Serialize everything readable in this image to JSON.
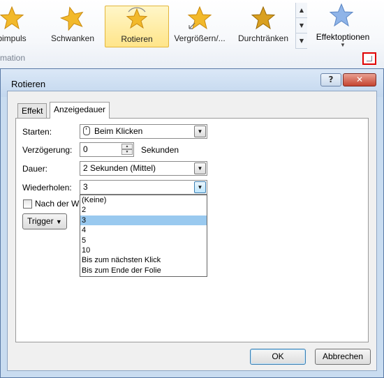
{
  "ribbon": {
    "gallery": [
      {
        "label": "bimpuls",
        "icon": "star-pulse-icon"
      },
      {
        "label": "Schwanken",
        "icon": "star-teeter-icon"
      },
      {
        "label": "Rotieren",
        "icon": "star-spin-icon",
        "selected": true
      },
      {
        "label": "Vergrößern/...",
        "icon": "star-grow-icon"
      },
      {
        "label": "Durchtränken",
        "icon": "star-saturate-icon"
      }
    ],
    "effect_options_label": "Effektoptionen",
    "group_label": "mation",
    "colors": {
      "star_gold": "#f2b92b",
      "star_blue": "#8fb4e8",
      "selected_bg": "#ffe58a",
      "highlight_border": "#e00000"
    }
  },
  "dialog": {
    "title": "Rotieren",
    "help_label": "?",
    "close_label": "✕",
    "tabs": [
      {
        "label": "Effekt",
        "active": false
      },
      {
        "label": "Anzeigedauer",
        "active": true
      }
    ],
    "fields": {
      "start_label": "Starten:",
      "start_value": "Beim Klicken",
      "delay_label": "Verzögerung:",
      "delay_value": "0",
      "delay_unit": "Sekunden",
      "duration_label": "Dauer:",
      "duration_value": "2 Sekunden (Mittel)",
      "repeat_label": "Wiederholen:",
      "repeat_value": "3",
      "rewind_label": "Nach der Wi",
      "trigger_label": "Trigger"
    },
    "repeat_options": [
      "(Keine)",
      "2",
      "3",
      "4",
      "5",
      "10",
      "Bis zum nächsten Klick",
      "Bis zum Ende der Folie"
    ],
    "repeat_selected_index": 2,
    "ok_label": "OK",
    "cancel_label": "Abbrechen"
  }
}
